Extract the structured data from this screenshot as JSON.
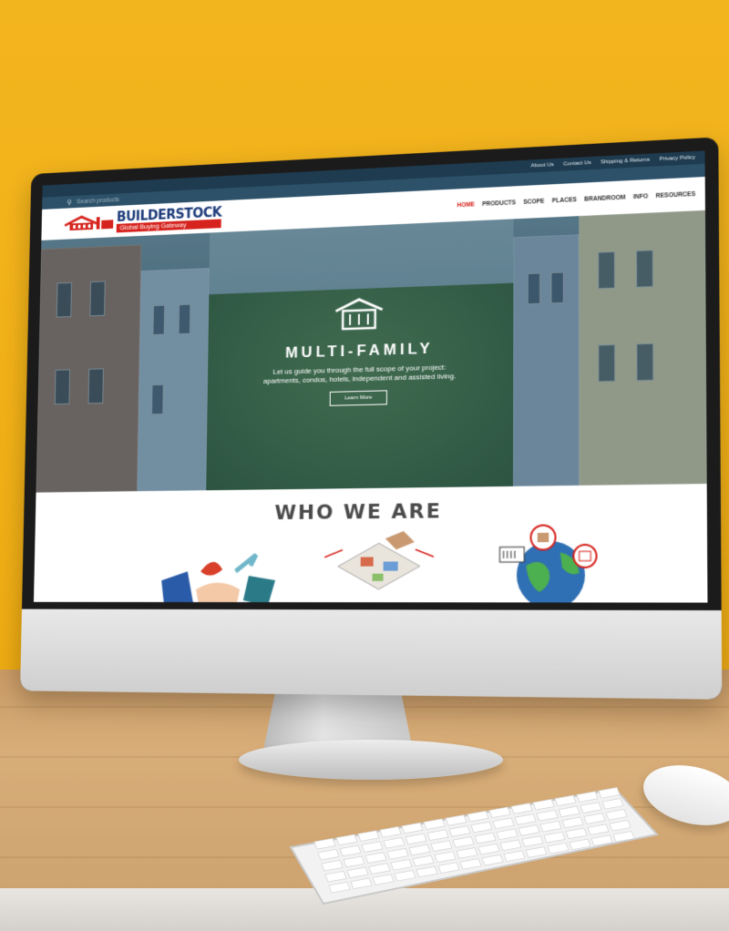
{
  "utility_links": [
    "About Us",
    "Contact Us",
    "Shipping & Returns",
    "Privacy Policy"
  ],
  "search": {
    "placeholder": "Search products"
  },
  "logo": {
    "title": "BUILDERSTOCK",
    "subtitle": "Global Buying Gateway"
  },
  "nav": [
    "HOME",
    "PRODUCTS",
    "SCOPE",
    "PLACES",
    "BRANDROOM",
    "INFO",
    "RESOURCES"
  ],
  "nav_active": "HOME",
  "hero": {
    "title": "MULTI-FAMILY",
    "text_line1": "Let us guide you through the full scope of your project:",
    "text_line2": "apartments, condos, hotels, independent and assisted living.",
    "button": "Learn More"
  },
  "who": {
    "title": "WHO WE ARE"
  },
  "colors": {
    "brand_blue": "#1d3b7a",
    "brand_red": "#d6231d",
    "utility_bar": "#1e3b4f",
    "background_yellow": "#f3b51e"
  },
  "icons": [
    "search-icon",
    "house-logo-icon",
    "house-hero-icon"
  ]
}
